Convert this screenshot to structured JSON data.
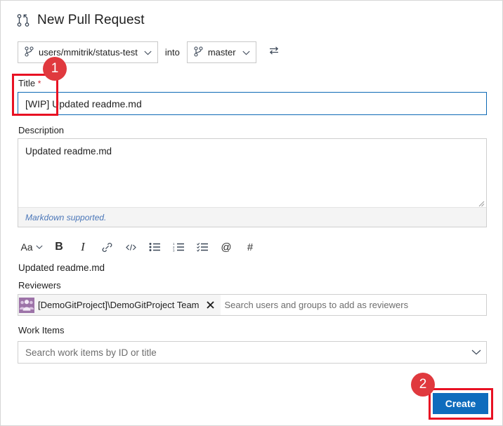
{
  "header": {
    "title": "New Pull Request",
    "icon": "pull-request-icon"
  },
  "branch_row": {
    "source_branch": "users/mmitrik/status-test",
    "into_label": "into",
    "target_branch": "master",
    "swap_icon": "swap-arrows-icon",
    "branch_icon": "branch-icon",
    "caret_icon": "chevron-down-icon"
  },
  "title_field": {
    "label": "Title",
    "required_marker": "*",
    "value": "[WIP] Updated readme.md",
    "placeholder": "Title"
  },
  "description_field": {
    "label": "Description",
    "value": "Updated readme.md",
    "placeholder": "Description",
    "markdown_note": "Markdown supported."
  },
  "markdown_toolbar": {
    "buttons": [
      {
        "name": "font-size-dropdown",
        "label": "Aa"
      },
      {
        "name": "bold-button",
        "label": "B"
      },
      {
        "name": "italic-button",
        "label": "I"
      },
      {
        "name": "link-button",
        "label": "link-icon"
      },
      {
        "name": "code-button",
        "label": "</>"
      },
      {
        "name": "bullet-list-button",
        "label": "bullet-list-icon"
      },
      {
        "name": "numbered-list-button",
        "label": "numbered-list-icon"
      },
      {
        "name": "task-list-button",
        "label": "task-list-icon"
      },
      {
        "name": "mention-button",
        "label": "@"
      },
      {
        "name": "hashtag-button",
        "label": "#"
      }
    ]
  },
  "preview": {
    "text": "Updated readme.md"
  },
  "reviewers_field": {
    "label": "Reviewers",
    "chip": {
      "name": "[DemoGitProject]\\DemoGitProject Team",
      "avatar": "group-avatar-icon",
      "remove_icon": "close-icon"
    },
    "placeholder": "Search users and groups to add as reviewers",
    "value": ""
  },
  "work_items_field": {
    "label": "Work Items",
    "placeholder": "Search work items by ID or title",
    "value": "",
    "caret_icon": "chevron-down-icon"
  },
  "actions": {
    "create_label": "Create"
  },
  "annotations": [
    {
      "badge": "1",
      "target": "title-field"
    },
    {
      "badge": "2",
      "target": "create-button"
    }
  ],
  "colors": {
    "accent_blue": "#0e6cbd",
    "focus_border": "#0d69b5",
    "annotation_red": "#e81123",
    "badge_red": "#e0393e",
    "avatar_purple": "#9d73a8",
    "link_blue": "#4a76b8"
  }
}
